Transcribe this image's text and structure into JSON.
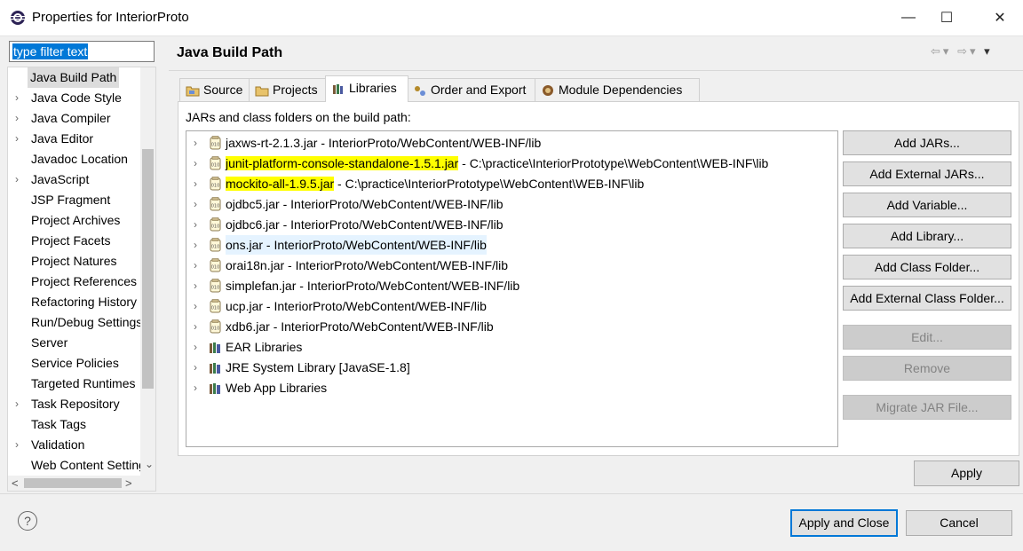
{
  "window": {
    "title": "Properties for InteriorProto",
    "minimize": "—",
    "maximize": "☐",
    "close": "✕"
  },
  "filter": {
    "value": "type filter text"
  },
  "tree": {
    "items": [
      {
        "label": "Java Build Path",
        "expandable": false,
        "selected": true
      },
      {
        "label": "Java Code Style",
        "expandable": true
      },
      {
        "label": "Java Compiler",
        "expandable": true
      },
      {
        "label": "Java Editor",
        "expandable": true
      },
      {
        "label": "Javadoc Location",
        "expandable": false
      },
      {
        "label": "JavaScript",
        "expandable": true
      },
      {
        "label": "JSP Fragment",
        "expandable": false
      },
      {
        "label": "Project Archives",
        "expandable": false
      },
      {
        "label": "Project Facets",
        "expandable": false
      },
      {
        "label": "Project Natures",
        "expandable": false
      },
      {
        "label": "Project References",
        "expandable": false
      },
      {
        "label": "Refactoring History",
        "expandable": false
      },
      {
        "label": "Run/Debug Settings",
        "expandable": false
      },
      {
        "label": "Server",
        "expandable": false
      },
      {
        "label": "Service Policies",
        "expandable": false
      },
      {
        "label": "Targeted Runtimes",
        "expandable": false
      },
      {
        "label": "Task Repository",
        "expandable": true
      },
      {
        "label": "Task Tags",
        "expandable": false
      },
      {
        "label": "Validation",
        "expandable": true
      },
      {
        "label": "Web Content Settings",
        "expandable": false
      }
    ]
  },
  "page": {
    "title": "Java Build Path",
    "tabs": [
      "Source",
      "Projects",
      "Libraries",
      "Order and Export",
      "Module Dependencies"
    ],
    "subheader": "JARs and class folders on the build path:",
    "libraries": [
      {
        "name": "jaxws-rt-2.1.3.jar",
        "path": " - InteriorProto/WebContent/WEB-INF/lib",
        "kind": "jar"
      },
      {
        "name": "junit-platform-console-standalone-1.5.1.jar",
        "path": " - C:\\practice\\InteriorPrototype\\WebContent\\WEB-INF\\lib",
        "kind": "jar",
        "highlight": true
      },
      {
        "name": "mockito-all-1.9.5.jar",
        "path": " - C:\\practice\\InteriorPrototype\\WebContent\\WEB-INF\\lib",
        "kind": "jar",
        "highlight": true
      },
      {
        "name": "ojdbc5.jar",
        "path": " - InteriorProto/WebContent/WEB-INF/lib",
        "kind": "jar"
      },
      {
        "name": "ojdbc6.jar",
        "path": " - InteriorProto/WebContent/WEB-INF/lib",
        "kind": "jar"
      },
      {
        "name": "ons.jar",
        "path": " - InteriorProto/WebContent/WEB-INF/lib",
        "kind": "jar",
        "hover": true
      },
      {
        "name": "orai18n.jar",
        "path": " - InteriorProto/WebContent/WEB-INF/lib",
        "kind": "jar"
      },
      {
        "name": "simplefan.jar",
        "path": " - InteriorProto/WebContent/WEB-INF/lib",
        "kind": "jar"
      },
      {
        "name": "ucp.jar",
        "path": " - InteriorProto/WebContent/WEB-INF/lib",
        "kind": "jar"
      },
      {
        "name": "xdb6.jar",
        "path": " - InteriorProto/WebContent/WEB-INF/lib",
        "kind": "jar"
      },
      {
        "name": "EAR Libraries",
        "path": "",
        "kind": "library"
      },
      {
        "name": "JRE System Library [JavaSE-1.8]",
        "path": "",
        "kind": "library"
      },
      {
        "name": "Web App Libraries",
        "path": "",
        "kind": "library"
      }
    ],
    "buttons": [
      {
        "label": "Add JARs...",
        "enabled": true
      },
      {
        "label": "Add External JARs...",
        "enabled": true
      },
      {
        "label": "Add Variable...",
        "enabled": true
      },
      {
        "label": "Add Library...",
        "enabled": true
      },
      {
        "label": "Add Class Folder...",
        "enabled": true
      },
      {
        "label": "Add External Class Folder...",
        "enabled": true
      },
      {
        "label": "Edit...",
        "enabled": false
      },
      {
        "label": "Remove",
        "enabled": false
      },
      {
        "label": "Migrate JAR File...",
        "enabled": false
      }
    ],
    "apply": "Apply"
  },
  "footer": {
    "help": "?",
    "apply_and_close": "Apply and Close",
    "cancel": "Cancel"
  },
  "colors": {
    "highlight": "#ffff00",
    "accent": "#0078d7"
  }
}
